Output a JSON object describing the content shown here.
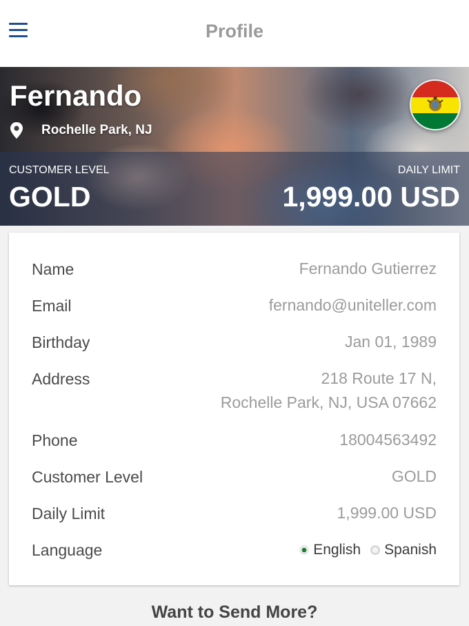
{
  "header": {
    "title": "Profile",
    "menu_icon": "hamburger-menu-icon"
  },
  "hero": {
    "name": "Fernando",
    "location": "Rochelle Park, NJ",
    "location_icon": "map-pin-icon",
    "flag": "bolivia-flag",
    "customer_level_label": "CUSTOMER LEVEL",
    "customer_level_value": "GOLD",
    "daily_limit_label": "DAILY LIMIT",
    "daily_limit_value": "1,999.00 USD"
  },
  "details": {
    "name_label": "Name",
    "name_value": "Fernando Gutierrez",
    "email_label": "Email",
    "email_value": "fernando@uniteller.com",
    "birthday_label": "Birthday",
    "birthday_value": "Jan 01, 1989",
    "address_label": "Address",
    "address_line1": "218 Route 17 N,",
    "address_line2": "Rochelle Park, NJ, USA 07662",
    "phone_label": "Phone",
    "phone_value": "18004563492",
    "level_label": "Customer Level",
    "level_value": "GOLD",
    "limit_label": "Daily Limit",
    "limit_value": "1,999.00 USD",
    "language_label": "Language",
    "language_options": [
      "English",
      "Spanish"
    ],
    "language_selected": "English"
  },
  "footer": {
    "send_more": "Want to Send More?"
  },
  "colors": {
    "menu_blue": "#1f4e8c",
    "title_gray": "#9a9a9a",
    "label_dark": "#4a4a4a",
    "value_gray": "#9b9b9b",
    "radio_selected": "#1c7a2a"
  }
}
